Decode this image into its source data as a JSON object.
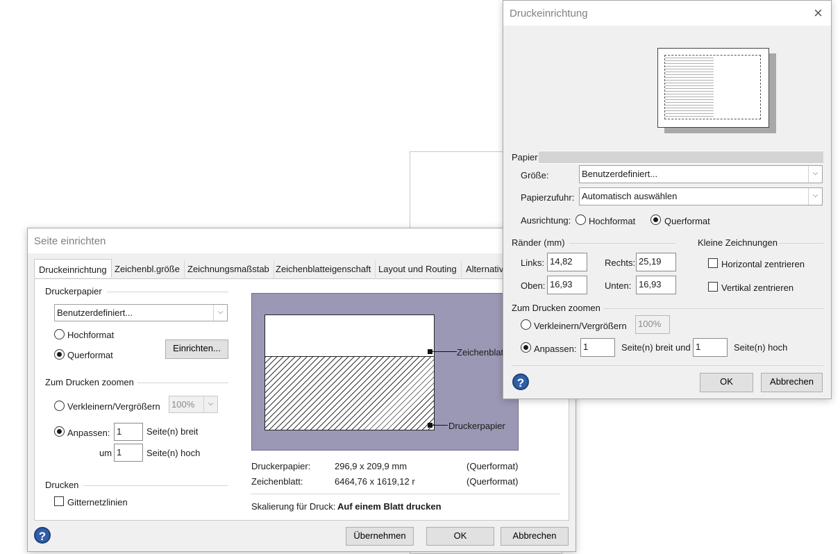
{
  "front": {
    "title": "Seite einrichten",
    "tabs": [
      {
        "label": "Druckeinrichtung"
      },
      {
        "label": "Zeichenbl.größe"
      },
      {
        "label": "Zeichnungsmaßstab"
      },
      {
        "label": "Zeichenblatteigenschaft"
      },
      {
        "label": "Layout und Routing"
      },
      {
        "label": "Alternativ"
      }
    ],
    "printer_paper_group": "Druckerpapier",
    "paper_size_value": "Benutzerdefiniert...",
    "portrait_label": "Hochformat",
    "landscape_label": "Querformat",
    "orientation_selected": "landscape",
    "setup_button": "Einrichten...",
    "zoom_group": "Zum Drucken zoomen",
    "scale_label": "Verkleinern/Vergrößern",
    "scale_value": "100%",
    "fit_label": "Anpassen:",
    "fit_selected": true,
    "fit_width_value": "1",
    "fit_width_unit": "Seite(n) breit",
    "fit_height_prefix": "um",
    "fit_height_value": "1",
    "fit_height_unit": "Seite(n) hoch",
    "print_group": "Drucken",
    "gridlines_label": "Gitternetzlinien",
    "gridlines_checked": false,
    "preview_callout_sheet": "Zeichenblatt",
    "preview_callout_paper": "Druckerpapier",
    "info": {
      "paper_label": "Druckerpapier:",
      "paper_size": "296,9 x 209,9 mm",
      "paper_orient": "(Querformat)",
      "sheet_label": "Zeichenblatt:",
      "sheet_size": "6464,76 x 1619,12 r",
      "sheet_orient": "(Querformat)"
    },
    "scaling_label": "Skalierung für Druck:",
    "scaling_value": "Auf einem Blatt drucken",
    "apply_button": "Übernehmen",
    "ok_button": "OK",
    "cancel_button": "Abbrechen"
  },
  "back": {
    "title": "Druckeinrichtung",
    "paper_group": "Papier",
    "size_label": "Größe:",
    "size_value": "Benutzerdefiniert...",
    "source_label": "Papierzufuhr:",
    "source_value": "Automatisch auswählen",
    "orientation_label": "Ausrichtung:",
    "portrait_label": "Hochformat",
    "landscape_label": "Querformat",
    "orientation_selected": "landscape",
    "margins_group": "Ränder (mm)",
    "left_label": "Links:",
    "left_value": "14,82",
    "right_label": "Rechts:",
    "right_value": "25,19",
    "top_label": "Oben:",
    "top_value": "16,93",
    "bottom_label": "Unten:",
    "bottom_value": "16,93",
    "small_group": "Kleine Zeichnungen",
    "center_h_label": "Horizontal zentrieren",
    "center_v_label": "Vertikal zentrieren",
    "zoom_group": "Zum Drucken zoomen",
    "scale_label": "Verkleinern/Vergrößern",
    "scale_value": "100%",
    "fit_label": "Anpassen:",
    "fit_width_value": "1",
    "fit_width_unit": "Seite(n) breit und",
    "fit_height_value": "1",
    "fit_height_unit": "Seite(n) hoch",
    "ok_button": "OK",
    "cancel_button": "Abbrechen"
  },
  "colors": {
    "preview_bg": "#9a98b4",
    "help_icon": "#2f5fa8",
    "title_text": "#808080"
  }
}
